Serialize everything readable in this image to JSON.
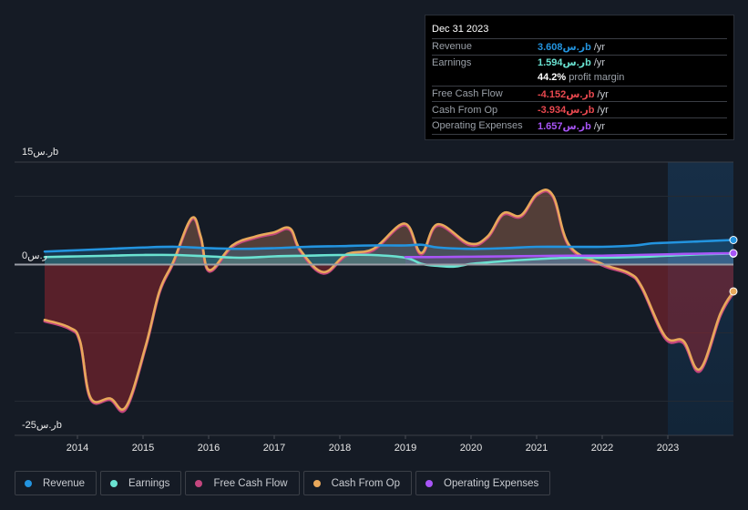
{
  "tooltip": {
    "date": "Dec 31 2023",
    "rows": [
      {
        "label": "Revenue",
        "value": "3.608ر.سb",
        "unit": "/yr",
        "color": "#2394df"
      },
      {
        "label": "Earnings",
        "value": "1.594ر.سb",
        "unit": "/yr",
        "color": "#6ae2d1"
      },
      {
        "label": "",
        "value": "44.2%",
        "unit": "profit margin",
        "color": "#ffffff"
      },
      {
        "label": "Free Cash Flow",
        "value": "-4.152ر.سb",
        "unit": "/yr",
        "color": "#e8484f"
      },
      {
        "label": "Cash From Op",
        "value": "-3.934ر.سb",
        "unit": "/yr",
        "color": "#e8484f"
      },
      {
        "label": "Operating Expenses",
        "value": "1.657ر.سb",
        "unit": "/yr",
        "color": "#a855f7"
      }
    ]
  },
  "legend": [
    {
      "label": "Revenue",
      "color": "#2394df"
    },
    {
      "label": "Earnings",
      "color": "#6ae2d1"
    },
    {
      "label": "Free Cash Flow",
      "color": "#c4467e"
    },
    {
      "label": "Cash From Op",
      "color": "#e8a85b"
    },
    {
      "label": "Operating Expenses",
      "color": "#a855f7"
    }
  ],
  "chart_data": {
    "type": "area",
    "title": "",
    "currency_unit": "ر.سb",
    "y_top_label": "15ر.سb",
    "y_zero_label": "0ر.س",
    "y_bottom_label": "-25ر.سb",
    "ylim": [
      -25,
      15
    ],
    "xlim": [
      2013.5,
      2024.0
    ],
    "x_ticks": [
      "2014",
      "2015",
      "2016",
      "2017",
      "2018",
      "2019",
      "2020",
      "2021",
      "2022",
      "2023"
    ],
    "x_tick_values": [
      2014,
      2015,
      2016,
      2017,
      2018,
      2019,
      2020,
      2021,
      2022,
      2023
    ],
    "gridlines_y": [
      15,
      10,
      0,
      -10,
      -20,
      -25
    ],
    "highlight_from": 2023.0,
    "series": [
      {
        "name": "Revenue",
        "color": "#2394df",
        "x": [
          2013.5,
          2014.0,
          2014.5,
          2015.0,
          2015.5,
          2016.0,
          2016.5,
          2017.0,
          2017.5,
          2018.0,
          2018.5,
          2019.0,
          2019.25,
          2019.5,
          2020.0,
          2020.5,
          2021.0,
          2021.5,
          2022.0,
          2022.5,
          2022.75,
          2023.0,
          2023.5,
          2024.0
        ],
        "values": [
          1.9,
          2.1,
          2.3,
          2.5,
          2.6,
          2.4,
          2.3,
          2.4,
          2.6,
          2.7,
          2.8,
          2.8,
          2.9,
          2.5,
          2.3,
          2.4,
          2.6,
          2.6,
          2.6,
          2.8,
          3.1,
          3.2,
          3.4,
          3.6
        ]
      },
      {
        "name": "Earnings",
        "color": "#6ae2d1",
        "x": [
          2013.5,
          2014.0,
          2014.5,
          2015.0,
          2015.5,
          2016.0,
          2016.5,
          2017.0,
          2017.5,
          2018.0,
          2018.5,
          2019.0,
          2019.25,
          2019.5,
          2019.75,
          2020.0,
          2020.5,
          2021.0,
          2021.5,
          2022.0,
          2022.5,
          2023.0,
          2023.5,
          2024.0
        ],
        "values": [
          1.1,
          1.2,
          1.3,
          1.4,
          1.4,
          1.2,
          1.0,
          1.2,
          1.3,
          1.4,
          1.4,
          1.0,
          0.1,
          -0.2,
          -0.3,
          0.1,
          0.5,
          0.8,
          1.0,
          1.0,
          1.1,
          1.3,
          1.5,
          1.6
        ]
      },
      {
        "name": "Free Cash Flow",
        "color": "#c4467e",
        "x": [
          2013.5,
          2013.875,
          2014.04,
          2014.2,
          2014.5,
          2014.74,
          2015.04,
          2015.25,
          2015.46,
          2015.74,
          2015.88,
          2016.01,
          2016.36,
          2016.71,
          2016.99,
          2017.24,
          2017.4,
          2017.75,
          2018.1,
          2018.51,
          2018.99,
          2019.24,
          2019.49,
          2019.97,
          2020.25,
          2020.49,
          2020.76,
          2021.01,
          2021.25,
          2021.5,
          2022.0,
          2022.4,
          2022.6,
          2022.96,
          2023.24,
          2023.49,
          2023.8,
          2024.0
        ],
        "values": [
          -8.3,
          -9.4,
          -11.4,
          -19.7,
          -19.8,
          -21.1,
          -12.1,
          -4.1,
          0.2,
          6.6,
          3.9,
          -1.0,
          2.6,
          3.9,
          4.5,
          5.1,
          1.9,
          -1.3,
          1.3,
          2.1,
          5.8,
          1.5,
          5.7,
          2.9,
          3.9,
          7.3,
          7.0,
          10.2,
          9.9,
          2.6,
          -0.1,
          -1.4,
          -3.4,
          -10.8,
          -11.5,
          -15.6,
          -7.5,
          -4.15
        ]
      },
      {
        "name": "Cash From Op",
        "color": "#e8a85b",
        "x": [
          2013.5,
          2013.875,
          2014.04,
          2014.2,
          2014.5,
          2014.74,
          2015.04,
          2015.25,
          2015.46,
          2015.74,
          2015.88,
          2016.01,
          2016.36,
          2016.71,
          2016.99,
          2017.24,
          2017.4,
          2017.75,
          2018.1,
          2018.51,
          2018.99,
          2019.24,
          2019.49,
          2019.97,
          2020.25,
          2020.49,
          2020.76,
          2021.01,
          2021.25,
          2021.5,
          2022.0,
          2022.4,
          2022.6,
          2022.96,
          2023.24,
          2023.49,
          2023.8,
          2024.0
        ],
        "values": [
          -8.1,
          -9.2,
          -11.2,
          -19.5,
          -19.6,
          -20.8,
          -11.9,
          -3.9,
          0.4,
          6.8,
          4.1,
          -0.8,
          2.8,
          4.1,
          4.7,
          5.3,
          2.1,
          -1.1,
          1.5,
          2.3,
          6.0,
          1.7,
          5.9,
          3.1,
          4.1,
          7.5,
          7.2,
          10.4,
          10.1,
          2.8,
          0.1,
          -1.2,
          -3.2,
          -10.5,
          -11.2,
          -15.3,
          -7.2,
          -3.93
        ]
      },
      {
        "name": "Operating Expenses",
        "color": "#a855f7",
        "x": [
          2019.0,
          2019.5,
          2020.0,
          2020.5,
          2021.0,
          2021.5,
          2022.0,
          2022.5,
          2023.0,
          2023.5,
          2024.0
        ],
        "values": [
          1.1,
          1.1,
          1.15,
          1.2,
          1.25,
          1.3,
          1.3,
          1.4,
          1.5,
          1.6,
          1.66
        ]
      }
    ]
  }
}
